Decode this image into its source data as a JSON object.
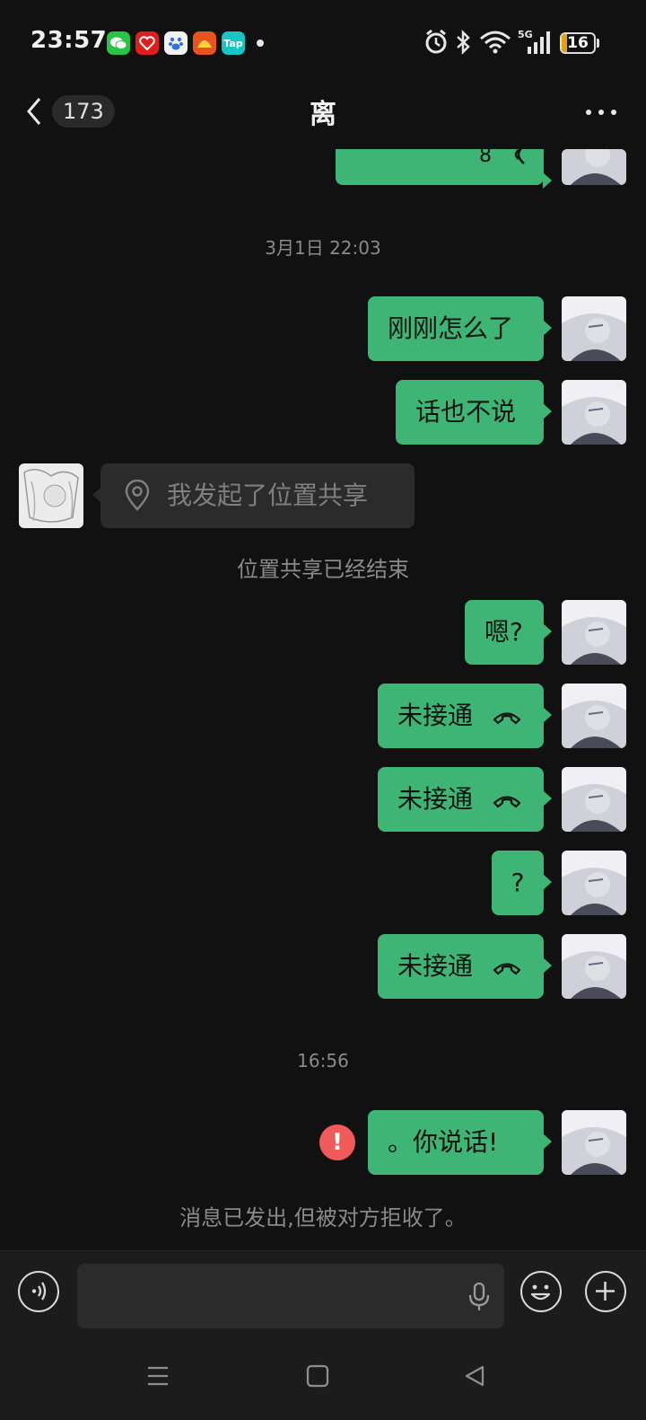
{
  "status_bar": {
    "time": "23:57",
    "battery": "16",
    "battery_level": 0.16,
    "network": "5G",
    "app_icons": [
      {
        "name": "wechat-icon",
        "color": "#28c445"
      },
      {
        "name": "qq-music-icon",
        "color": "#e01e1e"
      },
      {
        "name": "baidu-icon",
        "color": "#f2f2f2"
      },
      {
        "name": "red-app-icon",
        "color": "#e8541f"
      },
      {
        "name": "taptap-icon",
        "label": "Tap",
        "color": "#16c6c6"
      }
    ]
  },
  "header": {
    "unread_count": "173",
    "title": "离"
  },
  "messages": [
    {
      "type": "timestamp",
      "text": "3月1日 22:03"
    },
    {
      "type": "sent_text",
      "text": "刚刚怎么了"
    },
    {
      "type": "sent_text",
      "text": "话也不说"
    },
    {
      "type": "received_location",
      "text": "我发起了位置共享"
    },
    {
      "type": "system",
      "text": "位置共享已经结束"
    },
    {
      "type": "sent_text",
      "text": "嗯?"
    },
    {
      "type": "sent_call",
      "text": "未接通"
    },
    {
      "type": "sent_call",
      "text": "未接通"
    },
    {
      "type": "sent_text",
      "text": "?"
    },
    {
      "type": "sent_call",
      "text": "未接通"
    },
    {
      "type": "timestamp",
      "text": "16:56"
    },
    {
      "type": "sent_failed",
      "text": "。你说话!",
      "error_icon": "!"
    },
    {
      "type": "system",
      "text": "消息已发出,但被对方拒收了。"
    }
  ],
  "partial_top_bubble_text": "8",
  "colors": {
    "sent_bubble": "#3eb575",
    "error": "#f05a5a",
    "background": "#111111"
  }
}
